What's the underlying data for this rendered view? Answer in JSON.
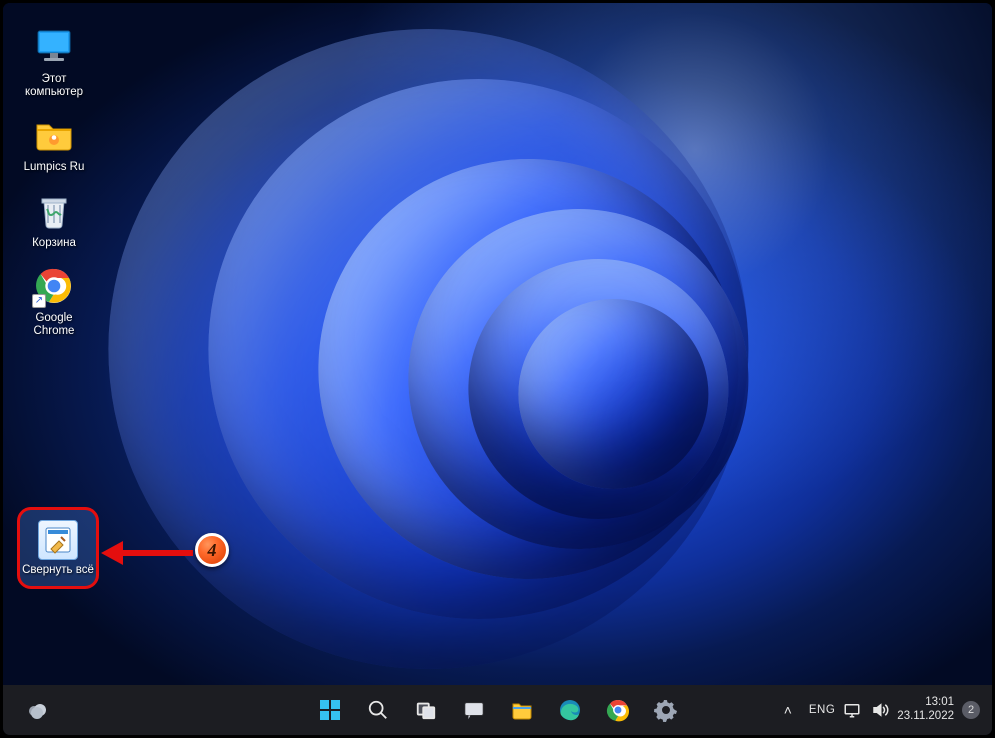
{
  "annotation": {
    "step_number": "4"
  },
  "desktop_icons": [
    {
      "id": "this-pc",
      "label": "Этот компьютер"
    },
    {
      "id": "lumpics",
      "label": "Lumpics Ru"
    },
    {
      "id": "recycle-bin",
      "label": "Корзина"
    },
    {
      "id": "chrome",
      "label": "Google Chrome"
    }
  ],
  "highlighted_shortcut": {
    "label": "Свернуть всё"
  },
  "taskbar": {
    "center_items": [
      {
        "id": "start",
        "name": "start-button"
      },
      {
        "id": "search",
        "name": "search-button"
      },
      {
        "id": "taskview",
        "name": "task-view-button"
      },
      {
        "id": "widgets",
        "name": "widgets-button"
      },
      {
        "id": "explorer",
        "name": "file-explorer-button"
      },
      {
        "id": "edge",
        "name": "edge-button"
      },
      {
        "id": "chrome",
        "name": "chrome-button"
      },
      {
        "id": "settings",
        "name": "settings-button"
      }
    ],
    "tray": {
      "chevron": "˄",
      "language": "ENG",
      "time": "13:01",
      "date": "23.11.2022",
      "notification_count": "2"
    }
  }
}
